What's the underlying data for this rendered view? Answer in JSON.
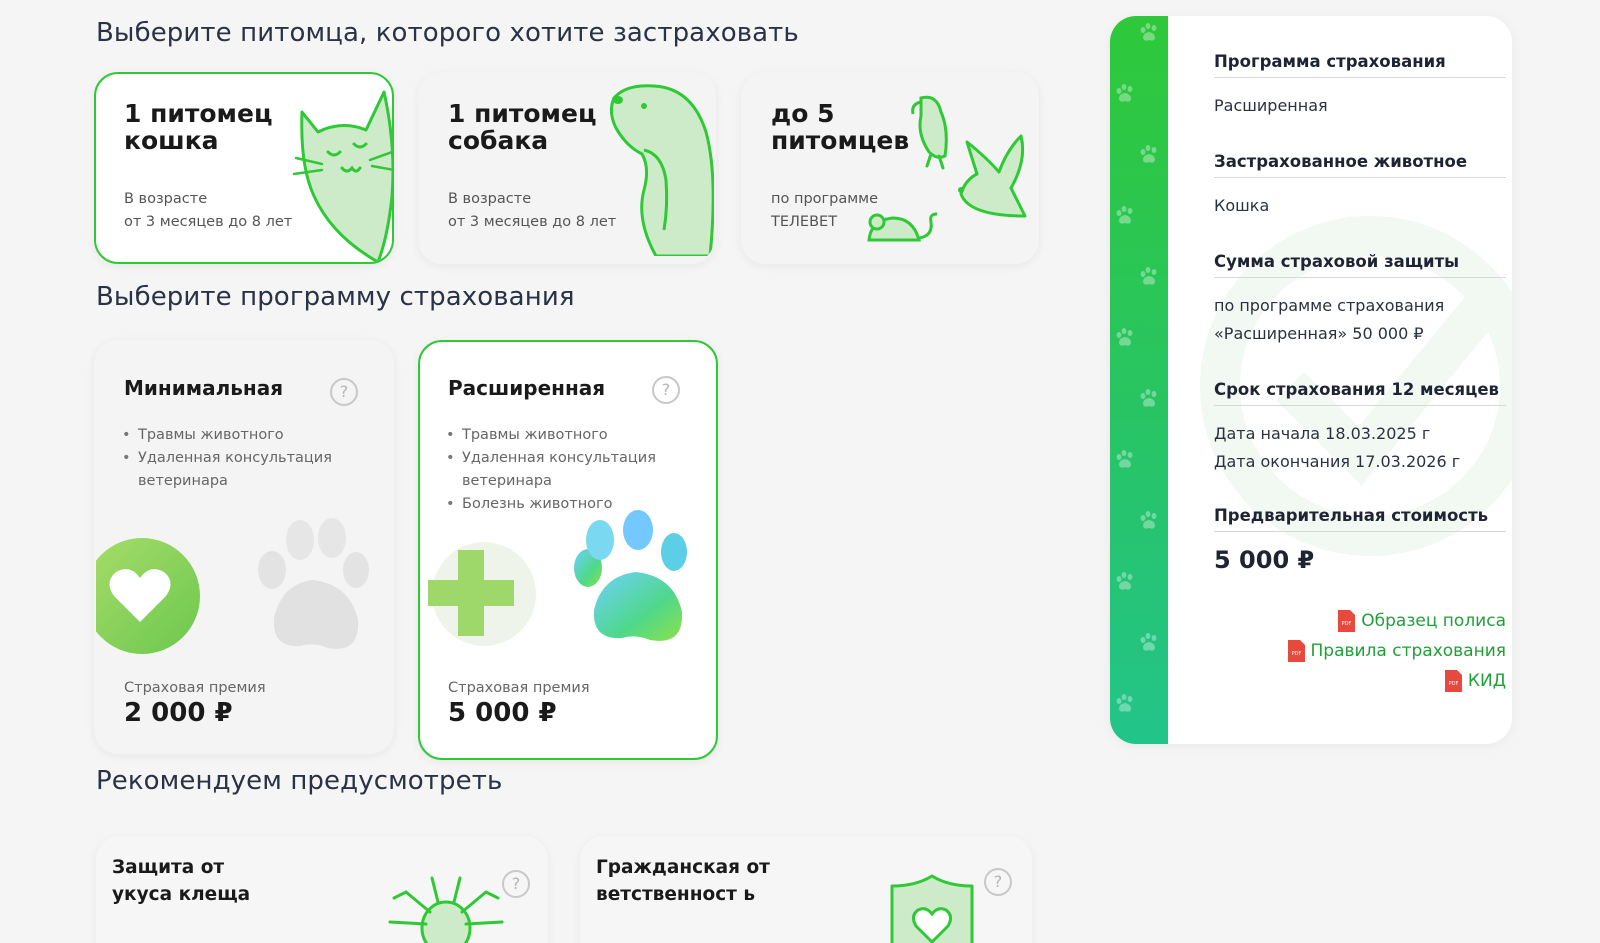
{
  "sections": {
    "choose_pet": "Выберите питомца, которого хотите застраховать",
    "choose_program": "Выберите программу страхования",
    "recommend": "Рекомендуем предусмотреть"
  },
  "pets": [
    {
      "line1": "1 питомец",
      "line2": "кошка",
      "desc1": "В возрасте",
      "desc2": "от 3 месяцев до 8 лет",
      "selected": true
    },
    {
      "line1": "1 питомец",
      "line2": "собака",
      "desc1": "В возрасте",
      "desc2": "от 3 месяцев до 8 лет",
      "selected": false
    },
    {
      "line1": "до 5",
      "line2": "питомцев",
      "desc1": "по программе",
      "desc2": "ТЕЛЕВЕТ",
      "selected": false
    }
  ],
  "programs": [
    {
      "name": "Минимальная",
      "features": [
        "Травмы животного",
        "Удаленная консультация ветеринара"
      ],
      "premium_label": "Страховая премия",
      "premium": "2 000 ₽",
      "selected": false
    },
    {
      "name": "Расширенная",
      "features": [
        "Травмы животного",
        "Удаленная консультация ветеринара",
        "Болезнь животного"
      ],
      "premium_label": "Страховая премия",
      "premium": "5 000 ₽",
      "selected": true
    }
  ],
  "help_glyph": "?",
  "summary": {
    "program_head": "Программа страхования",
    "program_value": "Расширенная",
    "animal_head": "Застрахованное животное",
    "animal_value": "Кошка",
    "sum_head": "Сумма страховой защиты",
    "sum_value_1": "по программе страхования",
    "sum_value_2": "«Расширенная» 50 000 ₽",
    "term_head": "Срок страхования 12 месяцев",
    "start": "Дата начала 18.03.2025 г",
    "end": "Дата окончания 17.03.2026 г",
    "cost_head": "Предварительная стоимость",
    "cost_value": "5 000 ₽",
    "links": [
      "Образец полиса",
      "Правила страхования",
      "КИД"
    ],
    "pdf_badge": "PDF"
  },
  "recommendations": [
    {
      "title": "Защита от укуса клеща"
    },
    {
      "title": "Гражданская ответственност ь"
    }
  ],
  "colors": {
    "accent": "#2ec935",
    "link": "#21a038",
    "stripe_top": "#2fc83a",
    "stripe_bottom": "#23c48a"
  }
}
